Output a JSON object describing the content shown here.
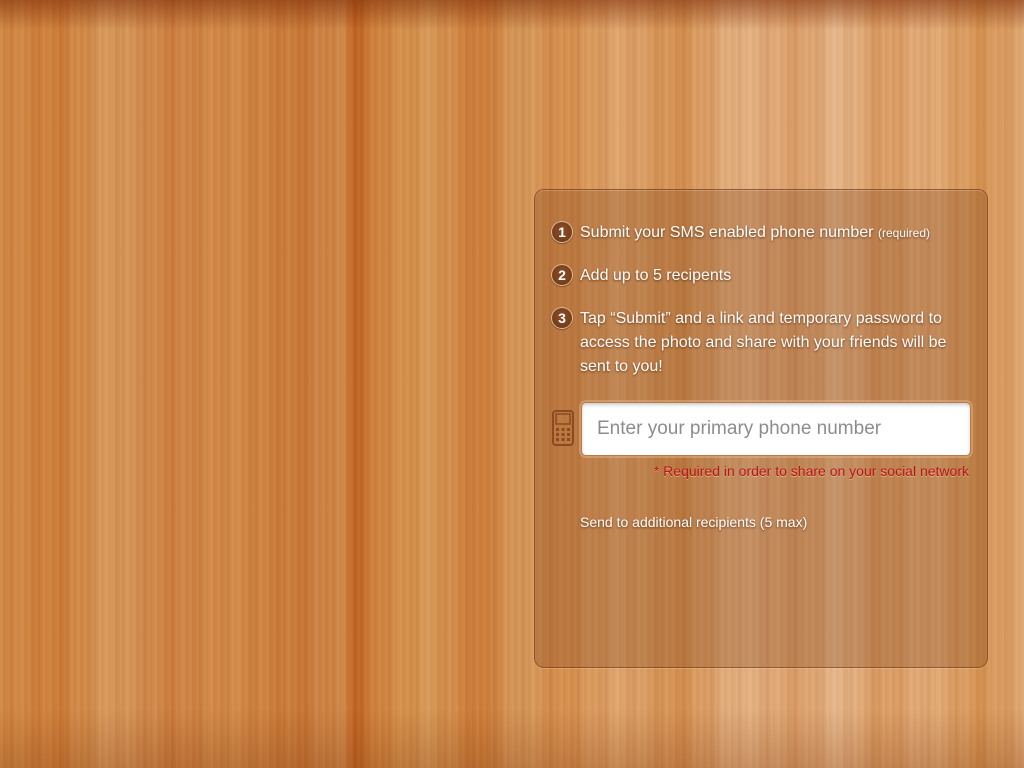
{
  "steps": [
    {
      "number": "1",
      "text": "Submit your SMS enabled phone number",
      "note": "(required)"
    },
    {
      "number": "2",
      "text": "Add up to 5 recipents",
      "note": ""
    },
    {
      "number": "3",
      "text": "Tap “Submit” and a link and temporary password to access the photo and share with your friends will be sent to you!",
      "note": ""
    }
  ],
  "phone_field": {
    "placeholder": "Enter your primary phone number",
    "value": "",
    "icon": "mobile-phone-icon"
  },
  "required_note": "* Required in order to share on your social network",
  "additional_link": "Send to additional recipients (5 max)",
  "colors": {
    "required_text": "#b8161b",
    "step_badge": "#7a4220"
  }
}
